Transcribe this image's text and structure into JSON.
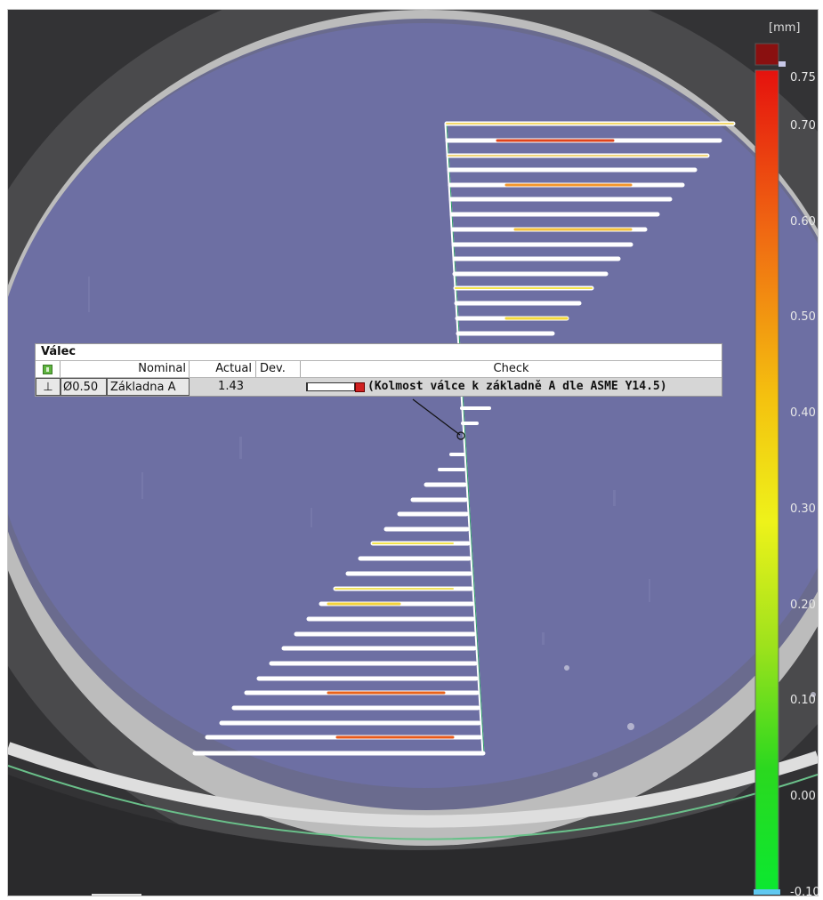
{
  "legend": {
    "unit": "[mm]",
    "ticks": [
      "0.75",
      "0.70",
      "0.60",
      "0.50",
      "0.40",
      "0.30",
      "0.20",
      "0.10",
      "0.00",
      "-0.10"
    ]
  },
  "callout": {
    "title": "Válec",
    "headers": {
      "nominal": "Nominal",
      "actual": "Actual",
      "dev": "Dev.",
      "check": "Check"
    },
    "row": {
      "symbol": "⊥",
      "tolerance": "Ø0.50",
      "datum": "Základna A",
      "actual": "1.43",
      "dev": "",
      "check": "(Kolmost válce k základně A dle ASME Y14.5)"
    }
  },
  "colors": {
    "surface": "#6c6fa1",
    "scale_top": "#d21a10",
    "scale_mid": "#f2f21a",
    "scale_bottom": "#18d21c",
    "out_of_range": "#8a1010"
  }
}
